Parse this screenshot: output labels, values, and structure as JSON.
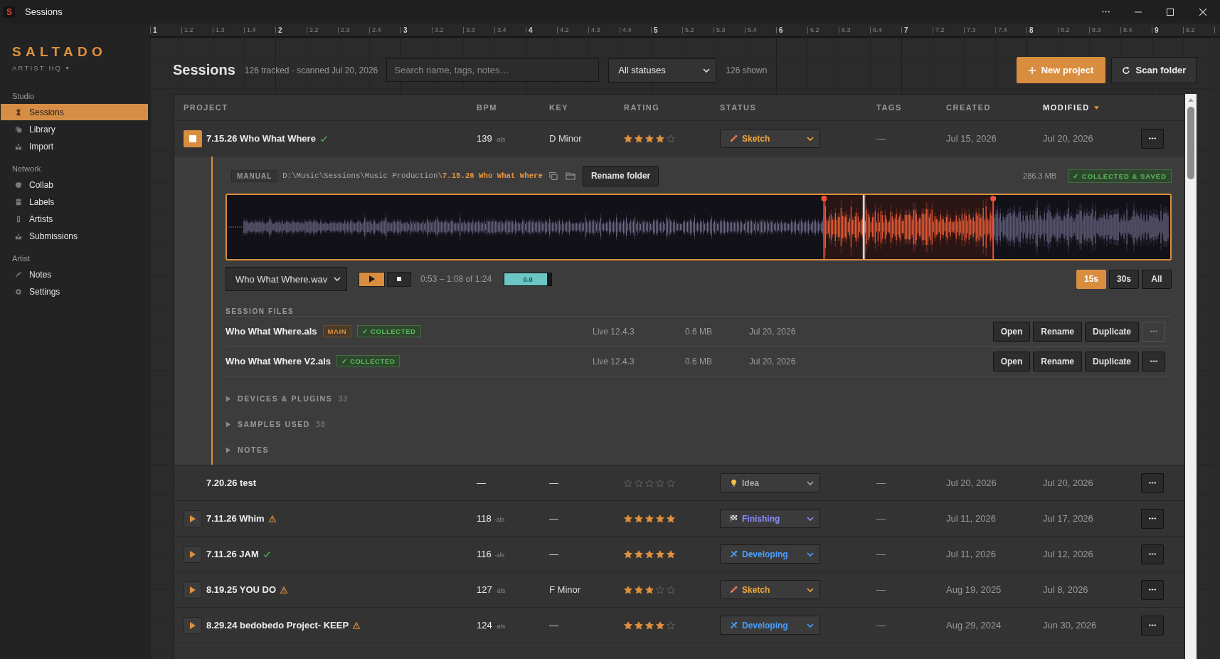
{
  "window": {
    "icon_letter": "S",
    "title": "Sessions"
  },
  "sidebar": {
    "brand": "SALTADO",
    "workspace": "ARTIST HQ",
    "sections": [
      {
        "title": "Studio",
        "items": [
          {
            "label": "Sessions",
            "kind": "sessions",
            "selected": true
          },
          {
            "label": "Library",
            "kind": "library",
            "selected": false
          },
          {
            "label": "Import",
            "kind": "import",
            "selected": false
          }
        ]
      },
      {
        "title": "Network",
        "items": [
          {
            "label": "Collab",
            "kind": "collab",
            "selected": false
          },
          {
            "label": "Labels",
            "kind": "labels",
            "selected": false
          },
          {
            "label": "Artists",
            "kind": "artists",
            "selected": false
          },
          {
            "label": "Submissions",
            "kind": "submissions",
            "selected": false
          }
        ]
      },
      {
        "title": "Artist",
        "items": [
          {
            "label": "Notes",
            "kind": "notes",
            "selected": false
          },
          {
            "label": "Settings",
            "kind": "settings",
            "selected": false
          }
        ]
      }
    ]
  },
  "ruler": [
    "1",
    "1.2",
    "1.3",
    "1.4",
    "2",
    "2.2",
    "2.3",
    "2.4",
    "3",
    "3.2",
    "3.3",
    "3.4",
    "4",
    "4.2",
    "4.3",
    "4.4",
    "5",
    "5.2",
    "5.3",
    "5.4",
    "6",
    "6.2",
    "6.3",
    "6.4",
    "7",
    "7.2",
    "7.3",
    "7.4",
    "8",
    "8.2",
    "8.3",
    "8.4",
    "9",
    "9.2"
  ],
  "header": {
    "title": "Sessions",
    "summary": "126 tracked · scanned Jul 20, 2026",
    "search": {
      "placeholder": "Search name, tags, notes…"
    },
    "status_filter": "All statuses",
    "shown_count": "126 shown",
    "buttons": [
      {
        "label": "New project",
        "kind": "primary"
      },
      {
        "label": "Scan folder",
        "kind": "secondary"
      }
    ]
  },
  "table": {
    "columns": [
      {
        "label": "PROJECT",
        "sorted": false
      },
      {
        "label": "BPM",
        "sorted": false
      },
      {
        "label": "KEY",
        "sorted": false
      },
      {
        "label": "RATING",
        "sorted": false
      },
      {
        "label": "STATUS",
        "sorted": false
      },
      {
        "label": "TAGS",
        "sorted": false
      },
      {
        "label": "CREATED",
        "sorted": false
      },
      {
        "label": "MODIFIED",
        "sorted": true
      }
    ],
    "rows": [
      {
        "name": "7.15.26 Who What Where",
        "kind": "collected",
        "has_audio": true,
        "playing": true,
        "expanded": true,
        "bpm": "139",
        "bpm_source": "·als",
        "key": "D Minor",
        "stars": 4,
        "status": {
          "label": "Sketch",
          "kind": "sketch",
          "color": "#f0a83c"
        },
        "tags": "—",
        "created": "Jul 15, 2026",
        "modified": "Jul 20, 2026",
        "details": {
          "source": "MANUAL",
          "path_prefix": "D:\\Music\\Sessions\\Music Production\\",
          "path_folder": "7.15.26 Who What Where",
          "rename_button": "Rename folder",
          "size": "286.3 MB",
          "state_badge": "✓ COLLECTED & SAVED",
          "audio_file": "Who What Where.wav",
          "time_range": "0:53 – 1:08 of 1:24",
          "gain": {
            "reading": "0.0",
            "level": 0.91
          },
          "zoom_options": [
            {
              "label": "15s",
              "selected": true
            },
            {
              "label": "30s",
              "selected": false
            },
            {
              "label": "All",
              "selected": false
            }
          ],
          "files_heading": "SESSION FILES",
          "files": [
            {
              "name": "Who What Where.als",
              "tags": [
                {
                  "label": "MAIN",
                  "kind": "main"
                },
                {
                  "label": "✓ COLLECTED",
                  "kind": "collected"
                }
              ],
              "version": "Live 12.4.3",
              "size": "0.6 MB",
              "date": "Jul 20, 2026",
              "actions": [
                "Open",
                "Rename",
                "Duplicate"
              ],
              "more_disabled": true
            },
            {
              "name": "Who What Where V2.als",
              "tags": [
                {
                  "label": "✓ COLLECTED",
                  "kind": "collected"
                }
              ],
              "version": "Live 12.4.3",
              "size": "0.6 MB",
              "date": "Jul 20, 2026",
              "actions": [
                "Open",
                "Rename",
                "Duplicate"
              ],
              "more_disabled": false
            }
          ],
          "sections": [
            {
              "label": "DEVICES & PLUGINS",
              "count": "33",
              "expanded": false
            },
            {
              "label": "SAMPLES USED",
              "count": "38",
              "expanded": false
            },
            {
              "label": "NOTES",
              "expanded": false
            }
          ]
        }
      },
      {
        "name": "7.20.26 test",
        "has_audio": false,
        "expanded": false,
        "bpm": "—",
        "key": "—",
        "stars": 0,
        "status": {
          "label": "Idea",
          "kind": "idea",
          "color": "#a8a8a8"
        },
        "tags": "—",
        "created": "Jul 20, 2026",
        "modified": "Jul 20, 2026"
      },
      {
        "name": "7.11.26 Whim",
        "kind": "warning",
        "has_audio": true,
        "playing": false,
        "expanded": false,
        "bpm": "118",
        "bpm_source": "·als",
        "key": "—",
        "stars": 5,
        "status": {
          "label": "Finishing",
          "kind": "finishing",
          "color": "#8c8cff"
        },
        "tags": "—",
        "created": "Jul 11, 2026",
        "modified": "Jul 17, 2026"
      },
      {
        "name": "7.11.26 JAM",
        "kind": "collected",
        "has_audio": true,
        "playing": false,
        "expanded": false,
        "bpm": "116",
        "bpm_source": "·als",
        "key": "—",
        "stars": 5,
        "status": {
          "label": "Developing",
          "kind": "developing",
          "color": "#4a9fff"
        },
        "tags": "—",
        "created": "Jul 11, 2026",
        "modified": "Jul 12, 2026"
      },
      {
        "name": "8.19.25 YOU DO",
        "kind": "warning",
        "has_audio": true,
        "playing": false,
        "expanded": false,
        "bpm": "127",
        "bpm_source": "·als",
        "key": "F Minor",
        "stars": 3,
        "status": {
          "label": "Sketch",
          "kind": "sketch",
          "color": "#f0a83c"
        },
        "tags": "—",
        "created": "Aug 19, 2025",
        "modified": "Jul 8, 2026"
      },
      {
        "name": "8.29.24 bedobedo Project- KEEP",
        "kind": "warning",
        "has_audio": true,
        "playing": false,
        "expanded": false,
        "bpm": "124",
        "bpm_source": "·als",
        "key": "—",
        "stars": 4,
        "status": {
          "label": "Developing",
          "kind": "developing",
          "color": "#4a9fff"
        },
        "tags": "—",
        "created": "Aug 29, 2024",
        "modified": "Jun 30, 2026"
      }
    ]
  }
}
